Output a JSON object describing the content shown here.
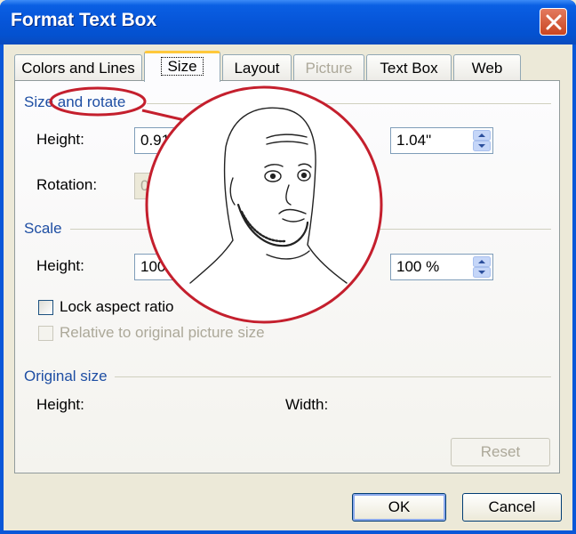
{
  "window": {
    "title": "Format Text Box"
  },
  "tabs": [
    {
      "label": "Colors and Lines",
      "state": "normal"
    },
    {
      "label": "Size",
      "state": "active"
    },
    {
      "label": "Layout",
      "state": "normal"
    },
    {
      "label": "Picture",
      "state": "disabled"
    },
    {
      "label": "Text Box",
      "state": "normal"
    },
    {
      "label": "Web",
      "state": "normal"
    }
  ],
  "size_rotate": {
    "section_pre": "Size",
    "section_post": " and rotate",
    "height_label": "Height:",
    "height_value": "0.91\"",
    "width_value": "1.04\"",
    "rotation_label": "Rotation:",
    "rotation_value": "0°"
  },
  "scale": {
    "section": "Scale",
    "height_label": "Height:",
    "height_value": "100 %",
    "width_value": "100 %",
    "lock_aspect": "Lock aspect ratio",
    "relative": "Relative to original picture size"
  },
  "original_size": {
    "section": "Original size",
    "height_label": "Height:",
    "width_label": "Width:",
    "reset": "Reset"
  },
  "buttons": {
    "ok": "OK",
    "cancel": "Cancel"
  },
  "colors": {
    "titlebar": "#0655d8",
    "section_text": "#1e4ea3",
    "annotation_red": "#c41f2d",
    "face": "#ffffff"
  }
}
